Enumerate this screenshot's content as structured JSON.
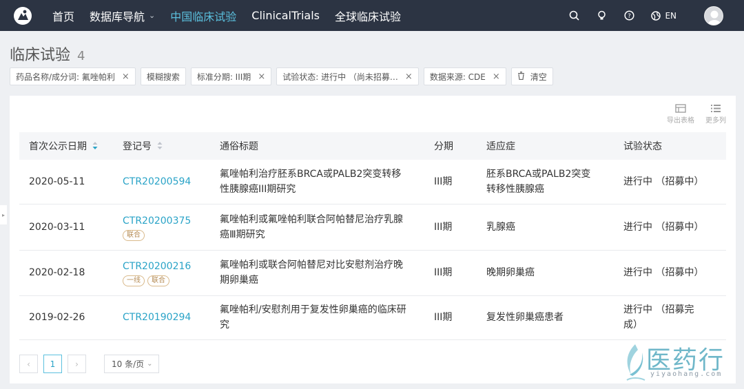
{
  "nav": {
    "items": [
      {
        "label": "首页",
        "active": false
      },
      {
        "label": "数据库导航",
        "active": false,
        "dropdown": true
      },
      {
        "label": "中国临床试验",
        "active": true
      },
      {
        "label": "ClinicalTrials",
        "active": false
      },
      {
        "label": "全球临床试验",
        "active": false
      }
    ],
    "lang": "EN",
    "colors": {
      "bg": "#2c3443",
      "active": "#5bc0de"
    }
  },
  "page": {
    "title": "临床试验",
    "count": "4"
  },
  "filters": [
    {
      "label": "药品名称/成分词: 氟唑帕利"
    },
    {
      "label": "模糊搜索"
    },
    {
      "label": "标准分期: III期"
    },
    {
      "label": "试验状态: 进行中 （尚未招募…"
    },
    {
      "label": "数据来源: CDE"
    }
  ],
  "clear_label": "清空",
  "tools": {
    "export": "导出表格",
    "more": "更多列"
  },
  "table": {
    "headers": [
      "首次公示日期",
      "登记号",
      "通俗标题",
      "分期",
      "适应症",
      "试验状态"
    ],
    "rows": [
      {
        "date": "2020-05-11",
        "id": "CTR20200594",
        "tags": [],
        "title_l1": "氟唑帕利治疗胚系BRCA或PALB2突变转移",
        "title_l2": "性胰腺癌III期研究",
        "phase": "III期",
        "ind_l1": "胚系BRCA或PALB2突变",
        "ind_l2": "转移性胰腺癌",
        "status_l1": "进行中 （招募中）",
        "status_l2": ""
      },
      {
        "date": "2020-03-11",
        "id": "CTR20200375",
        "tags": [
          "联合"
        ],
        "title_l1": "氟唑帕利或氟唑帕利联合阿帕替尼治疗乳腺",
        "title_l2": "癌Ⅲ期研究",
        "phase": "III期",
        "ind_l1": "乳腺癌",
        "ind_l2": "",
        "status_l1": "进行中 （招募中）",
        "status_l2": ""
      },
      {
        "date": "2020-02-18",
        "id": "CTR20200216",
        "tags": [
          "一线",
          "联合"
        ],
        "title_l1": "氟唑帕利或联合阿帕替尼对比安慰剂治疗晚",
        "title_l2": "期卵巢癌",
        "phase": "III期",
        "ind_l1": "晚期卵巢癌",
        "ind_l2": "",
        "status_l1": "进行中 （招募中）",
        "status_l2": ""
      },
      {
        "date": "2019-02-26",
        "id": "CTR20190294",
        "tags": [],
        "title_l1": "氟唑帕利/安慰剂用于复发性卵巢癌的临床研",
        "title_l2": "究",
        "phase": "III期",
        "ind_l1": "复发性卵巢癌患者",
        "ind_l2": "",
        "status_l1": "进行中 （招募完",
        "status_l2": "成）"
      }
    ]
  },
  "pager": {
    "prev": "‹",
    "current": "1",
    "next": "›",
    "page_size": "10 条/页"
  },
  "watermark": {
    "name": "医药行",
    "url": "yiyaohang.com"
  }
}
